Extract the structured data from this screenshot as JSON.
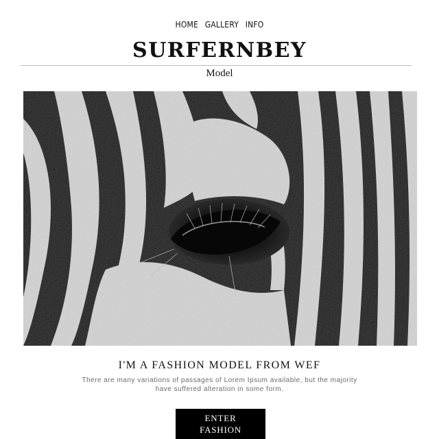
{
  "nav": {
    "items": [
      "HOME",
      "GALLERY",
      "INFO"
    ]
  },
  "brand": {
    "name": "SURFERNBEY",
    "subtitle": "Model"
  },
  "hero": {
    "alt": "Black and white close-up of a zebra eye"
  },
  "intro": {
    "headline": "I'M A FASHION MODEL FROM WEF",
    "description_line1": "There are many variations of passages of Lorem Ipsum available, but the majority",
    "description_line2": "have suffered alteration in some form."
  },
  "cta": {
    "line1": "ENTER",
    "line2": "FASHION"
  },
  "colors": {
    "background": "#ffffff",
    "text": "#111111",
    "muted": "#6b6b6b",
    "button": "#000000"
  }
}
